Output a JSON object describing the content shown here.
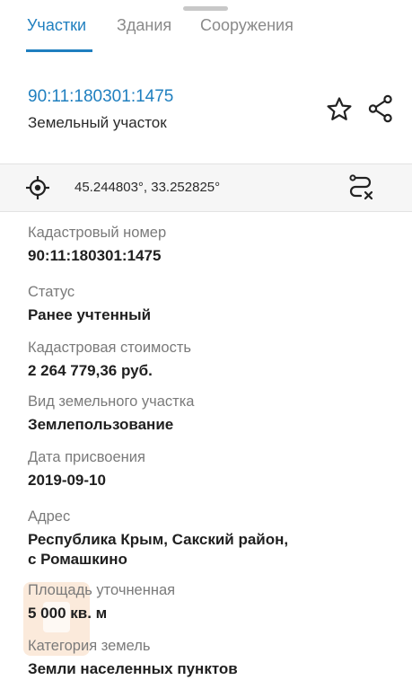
{
  "tabs": [
    {
      "label": "Участки",
      "active": true
    },
    {
      "label": "Здания",
      "active": false
    },
    {
      "label": "Сооружения",
      "active": false
    }
  ],
  "header": {
    "cadastral_link": "90:11:180301:1475",
    "object_type": "Земельный участок"
  },
  "coords": {
    "text": "45.244803°, 33.252825°"
  },
  "details": {
    "cadastral_number": {
      "label": "Кадастровый номер",
      "value": "90:11:180301:1475"
    },
    "status": {
      "label": "Статус",
      "value": "Ранее учтенный"
    },
    "value": {
      "label": "Кадастровая стоимость",
      "value": "2 264 779,36 руб."
    },
    "land_use": {
      "label": "Вид земельного участка",
      "value": "Землепользование"
    },
    "date": {
      "label": "Дата присвоения",
      "value": "2019-09-10"
    },
    "address": {
      "label": "Адрес",
      "line1": "Республика Крым, Сакский район,",
      "line2": "с Ромашкино"
    },
    "area": {
      "label": "Площадь уточненная",
      "value": "5 000 кв. м"
    },
    "category": {
      "label": "Категория земель",
      "value": "Земли населенных пунктов"
    }
  },
  "icons": {
    "favorite": "star-icon",
    "share": "share-icon",
    "locate": "crosshair-icon",
    "route": "route-cancel-icon"
  },
  "colors": {
    "accent": "#1f7fbf",
    "label_gray": "#7a7a7a",
    "bar_bg": "#f6f6f6"
  }
}
